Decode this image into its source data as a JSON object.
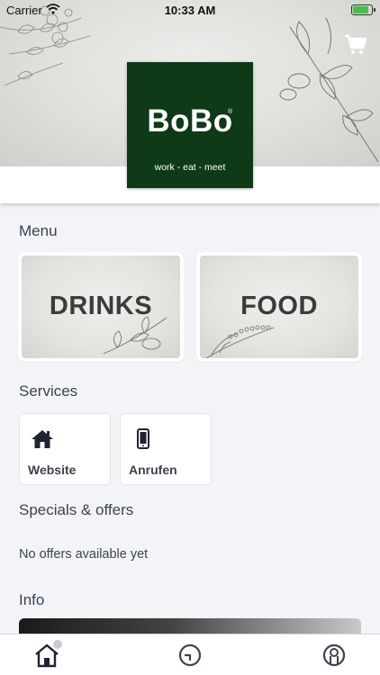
{
  "status_bar": {
    "carrier": "Carrier",
    "time": "10:33 AM"
  },
  "brand": {
    "name": "BoBo",
    "registered": "®",
    "tagline": "work - eat - meet",
    "color": "#0f3a18"
  },
  "header": {
    "cart_icon": "cart-icon"
  },
  "menu": {
    "title": "Menu",
    "cards": [
      {
        "label": "DRINKS"
      },
      {
        "label": "FOOD"
      }
    ]
  },
  "services": {
    "title": "Services",
    "items": [
      {
        "label": "Website",
        "icon": "home-icon"
      },
      {
        "label": "Anrufen",
        "icon": "phone-icon"
      }
    ]
  },
  "specials": {
    "title": "Specials & offers",
    "empty_text": "No offers available yet"
  },
  "info": {
    "title": "Info"
  },
  "tabbar": {
    "tabs": [
      {
        "icon": "home-icon",
        "active": true
      },
      {
        "icon": "clock-icon"
      },
      {
        "icon": "profile-icon"
      }
    ]
  }
}
